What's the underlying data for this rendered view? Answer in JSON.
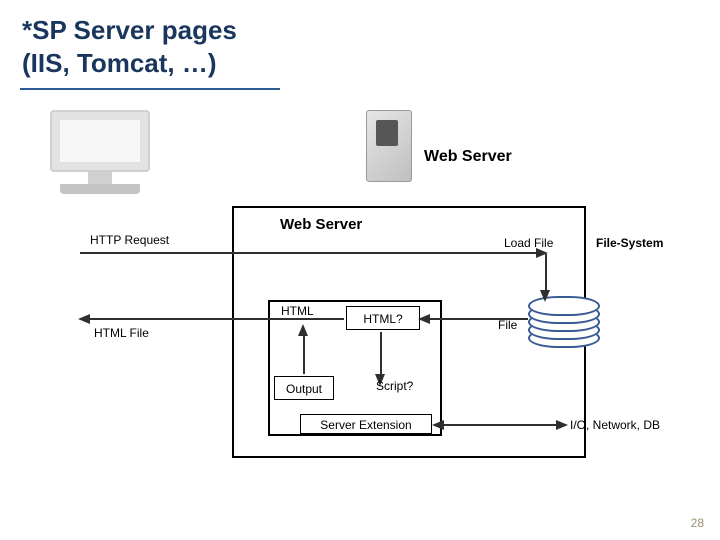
{
  "title_line1": "*SP Server pages",
  "title_line2": "(IIS, Tomcat, …)",
  "server_label": "Web Server",
  "ws_box_title": "Web Server",
  "http_request": "HTTP Request",
  "html_file": "HTML File",
  "html": "HTML",
  "load_file": "Load File",
  "file_system": "File-System",
  "file": "File",
  "html_q": "HTML?",
  "output": "Output",
  "script_q": "Script?",
  "server_extension": "Server Extension",
  "io_network_db": "I/O, Network, DB",
  "page_number": "28"
}
